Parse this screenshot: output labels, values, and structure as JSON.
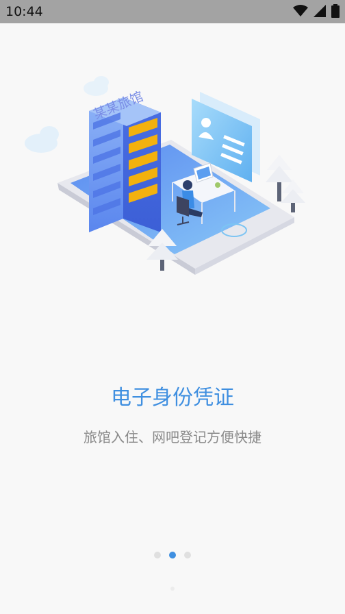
{
  "status": {
    "time": "10:44"
  },
  "illustration": {
    "sign": "某某旅馆"
  },
  "content": {
    "title": "电子身份凭证",
    "subtitle": "旅馆入住、网吧登记方便快捷"
  },
  "pager": {
    "count": 3,
    "active_index": 1
  },
  "colors": {
    "accent": "#3f8fe0",
    "subtitle": "#8a8a8a",
    "status_bar": "#a3a3a3"
  }
}
